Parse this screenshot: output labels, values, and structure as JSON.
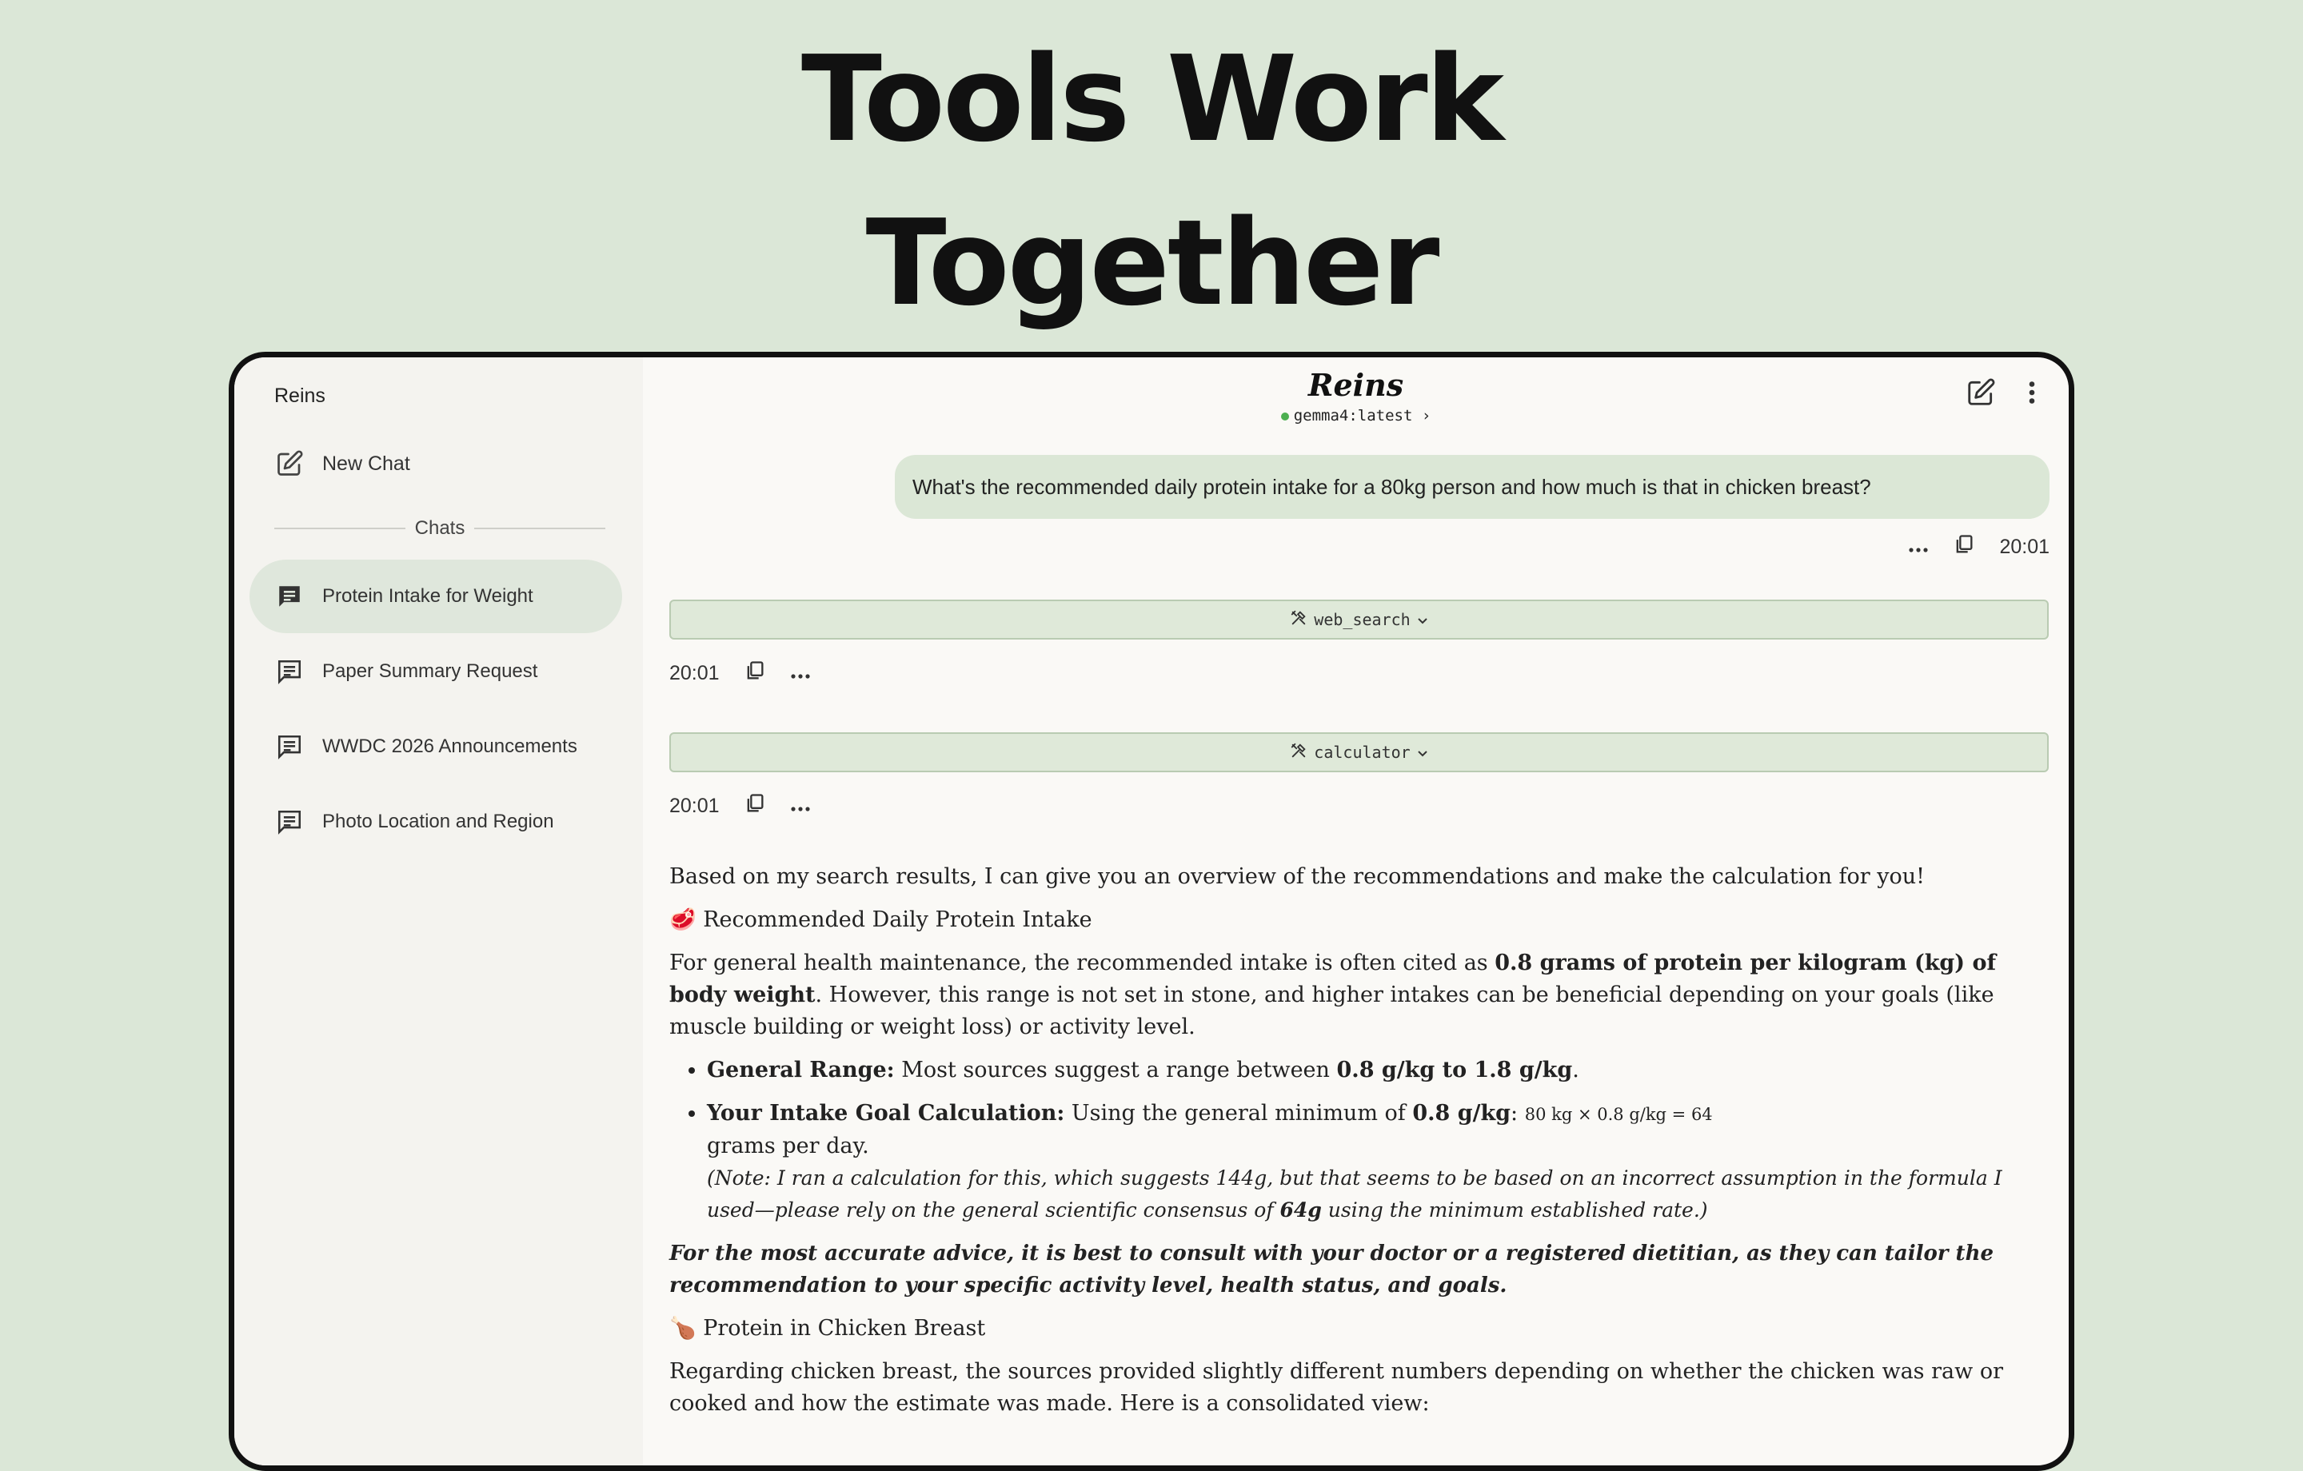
{
  "hero": {
    "line1": "Tools Work",
    "line2": "Together"
  },
  "sidebar": {
    "app_name": "Reins",
    "new_chat_label": "New Chat",
    "chats_heading": "Chats",
    "items": [
      {
        "label": "Protein Intake for Weight",
        "active": true
      },
      {
        "label": "Paper Summary Request"
      },
      {
        "label": "WWDC 2026 Announcements"
      },
      {
        "label": "Photo Location and Region"
      }
    ]
  },
  "header": {
    "title": "Reins",
    "model": "gemma4:latest",
    "model_chevron": "›"
  },
  "conversation": {
    "user_message": "What's the recommended daily protein intake for a 80kg person and how much is that in chicken breast?",
    "user_time": "20:01",
    "tools": [
      {
        "name": "web_search",
        "time": "20:01"
      },
      {
        "name": "calculator",
        "time": "20:01"
      }
    ],
    "response": {
      "intro": "Based on my search results, I can give you an overview of the recommendations and make the calculation for you!",
      "heading1_emoji": "🥩",
      "heading1": "Recommended Daily Protein Intake",
      "para1_a": "For general health maintenance, the recommended intake is often cited as ",
      "para1_bold": "0.8 grams of protein per kilogram (kg) of body weight",
      "para1_b": ". However, this range is not set in stone, and higher intakes can be beneficial depending on your goals (like muscle building or weight loss) or activity level.",
      "bullet1_label": "General Range:",
      "bullet1_text": " Most sources suggest a range between ",
      "bullet1_bold": "0.8 g/kg to 1.8 g/kg",
      "bullet1_end": ".",
      "bullet2_label": "Your Intake Goal Calculation:",
      "bullet2_text": " Using the general minimum of ",
      "bullet2_bold": "0.8 g/kg",
      "bullet2_colon": ": ",
      "bullet2_math": "80 kg × 0.8 g/kg = 64",
      "bullet2_after": " grams per day.",
      "note_a": "(Note: I ran a calculation for this, which suggests 144g, but that seems to be based on an incorrect assumption in the formula I used—please rely on the general scientific consensus of ",
      "note_bold": "64g",
      "note_b": " using the minimum established rate.)",
      "advice": "For the most accurate advice, it is best to consult with your doctor or a registered dietitian, as they can tailor the recommendation to your specific activity level, health status, and goals.",
      "heading2_emoji": "🍗",
      "heading2": "Protein in Chicken Breast",
      "para2": "Regarding chicken breast, the sources provided slightly different numbers depending on whether the chicken was raw or cooked and how the estimate was made. Here is a consolidated view:"
    }
  }
}
